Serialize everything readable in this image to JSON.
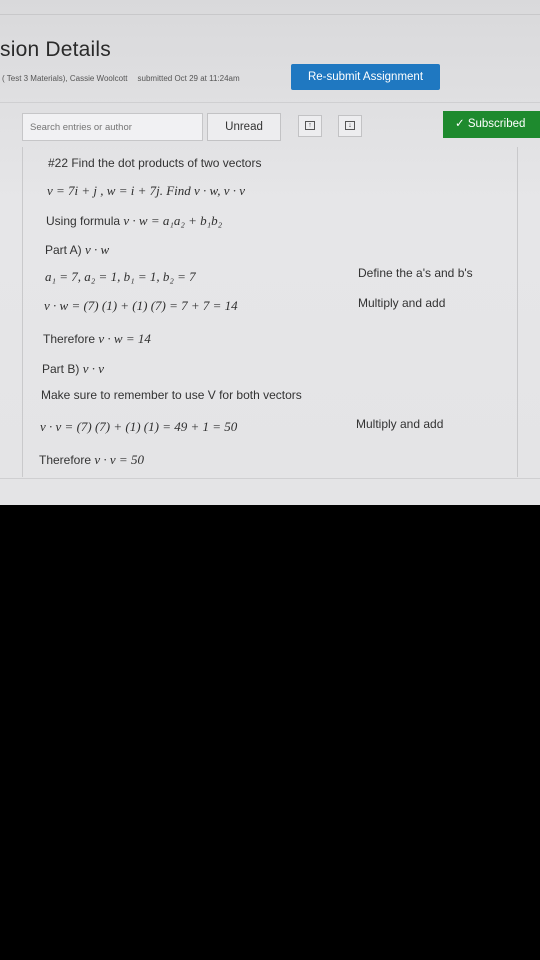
{
  "header": {
    "title": "sion Details",
    "meta_course": "( Test 3 Materials), Cassie Woolcott",
    "meta_submitted": "submitted Oct 29 at 11:24am",
    "resubmit_label": "Re-submit Assignment"
  },
  "toolbar": {
    "search_placeholder": "Search entries or author",
    "unread_label": "Unread",
    "subscribed_label": "Subscribed",
    "check_glyph": "✓",
    "up_glyph": "↑",
    "down_glyph": "↓"
  },
  "entry": {
    "heading": "#22 Find the dot products of two vectors",
    "given": "v = 7i + j ,  w = i + 7j.  Find v · w,  v · v",
    "formula_label": "Using formula",
    "formula": "v · w = a₁a₂ + b₁b₂",
    "part_a_label": "Part A)",
    "part_a_expr": "v · w",
    "define": "a₁ = 7,  a₂ = 1,  b₁ = 1,  b₂ = 7",
    "define_note": "Define the a's and b's",
    "calc_a": "v · w = (7) (1) + (1) (7) =  7 + 7 = 14",
    "calc_a_note": "Multiply and add",
    "therefore_label": "Therefore",
    "therefore_a": "v · w = 14",
    "part_b_label": "Part B)",
    "part_b_expr": "v · v",
    "reminder": "Make sure to remember to use V for both vectors",
    "calc_b": "v · v = (7) (7) + (1) (1) =  49 + 1 = 50",
    "calc_b_note": "Multiply and add",
    "therefore_b": "v · v = 50"
  }
}
